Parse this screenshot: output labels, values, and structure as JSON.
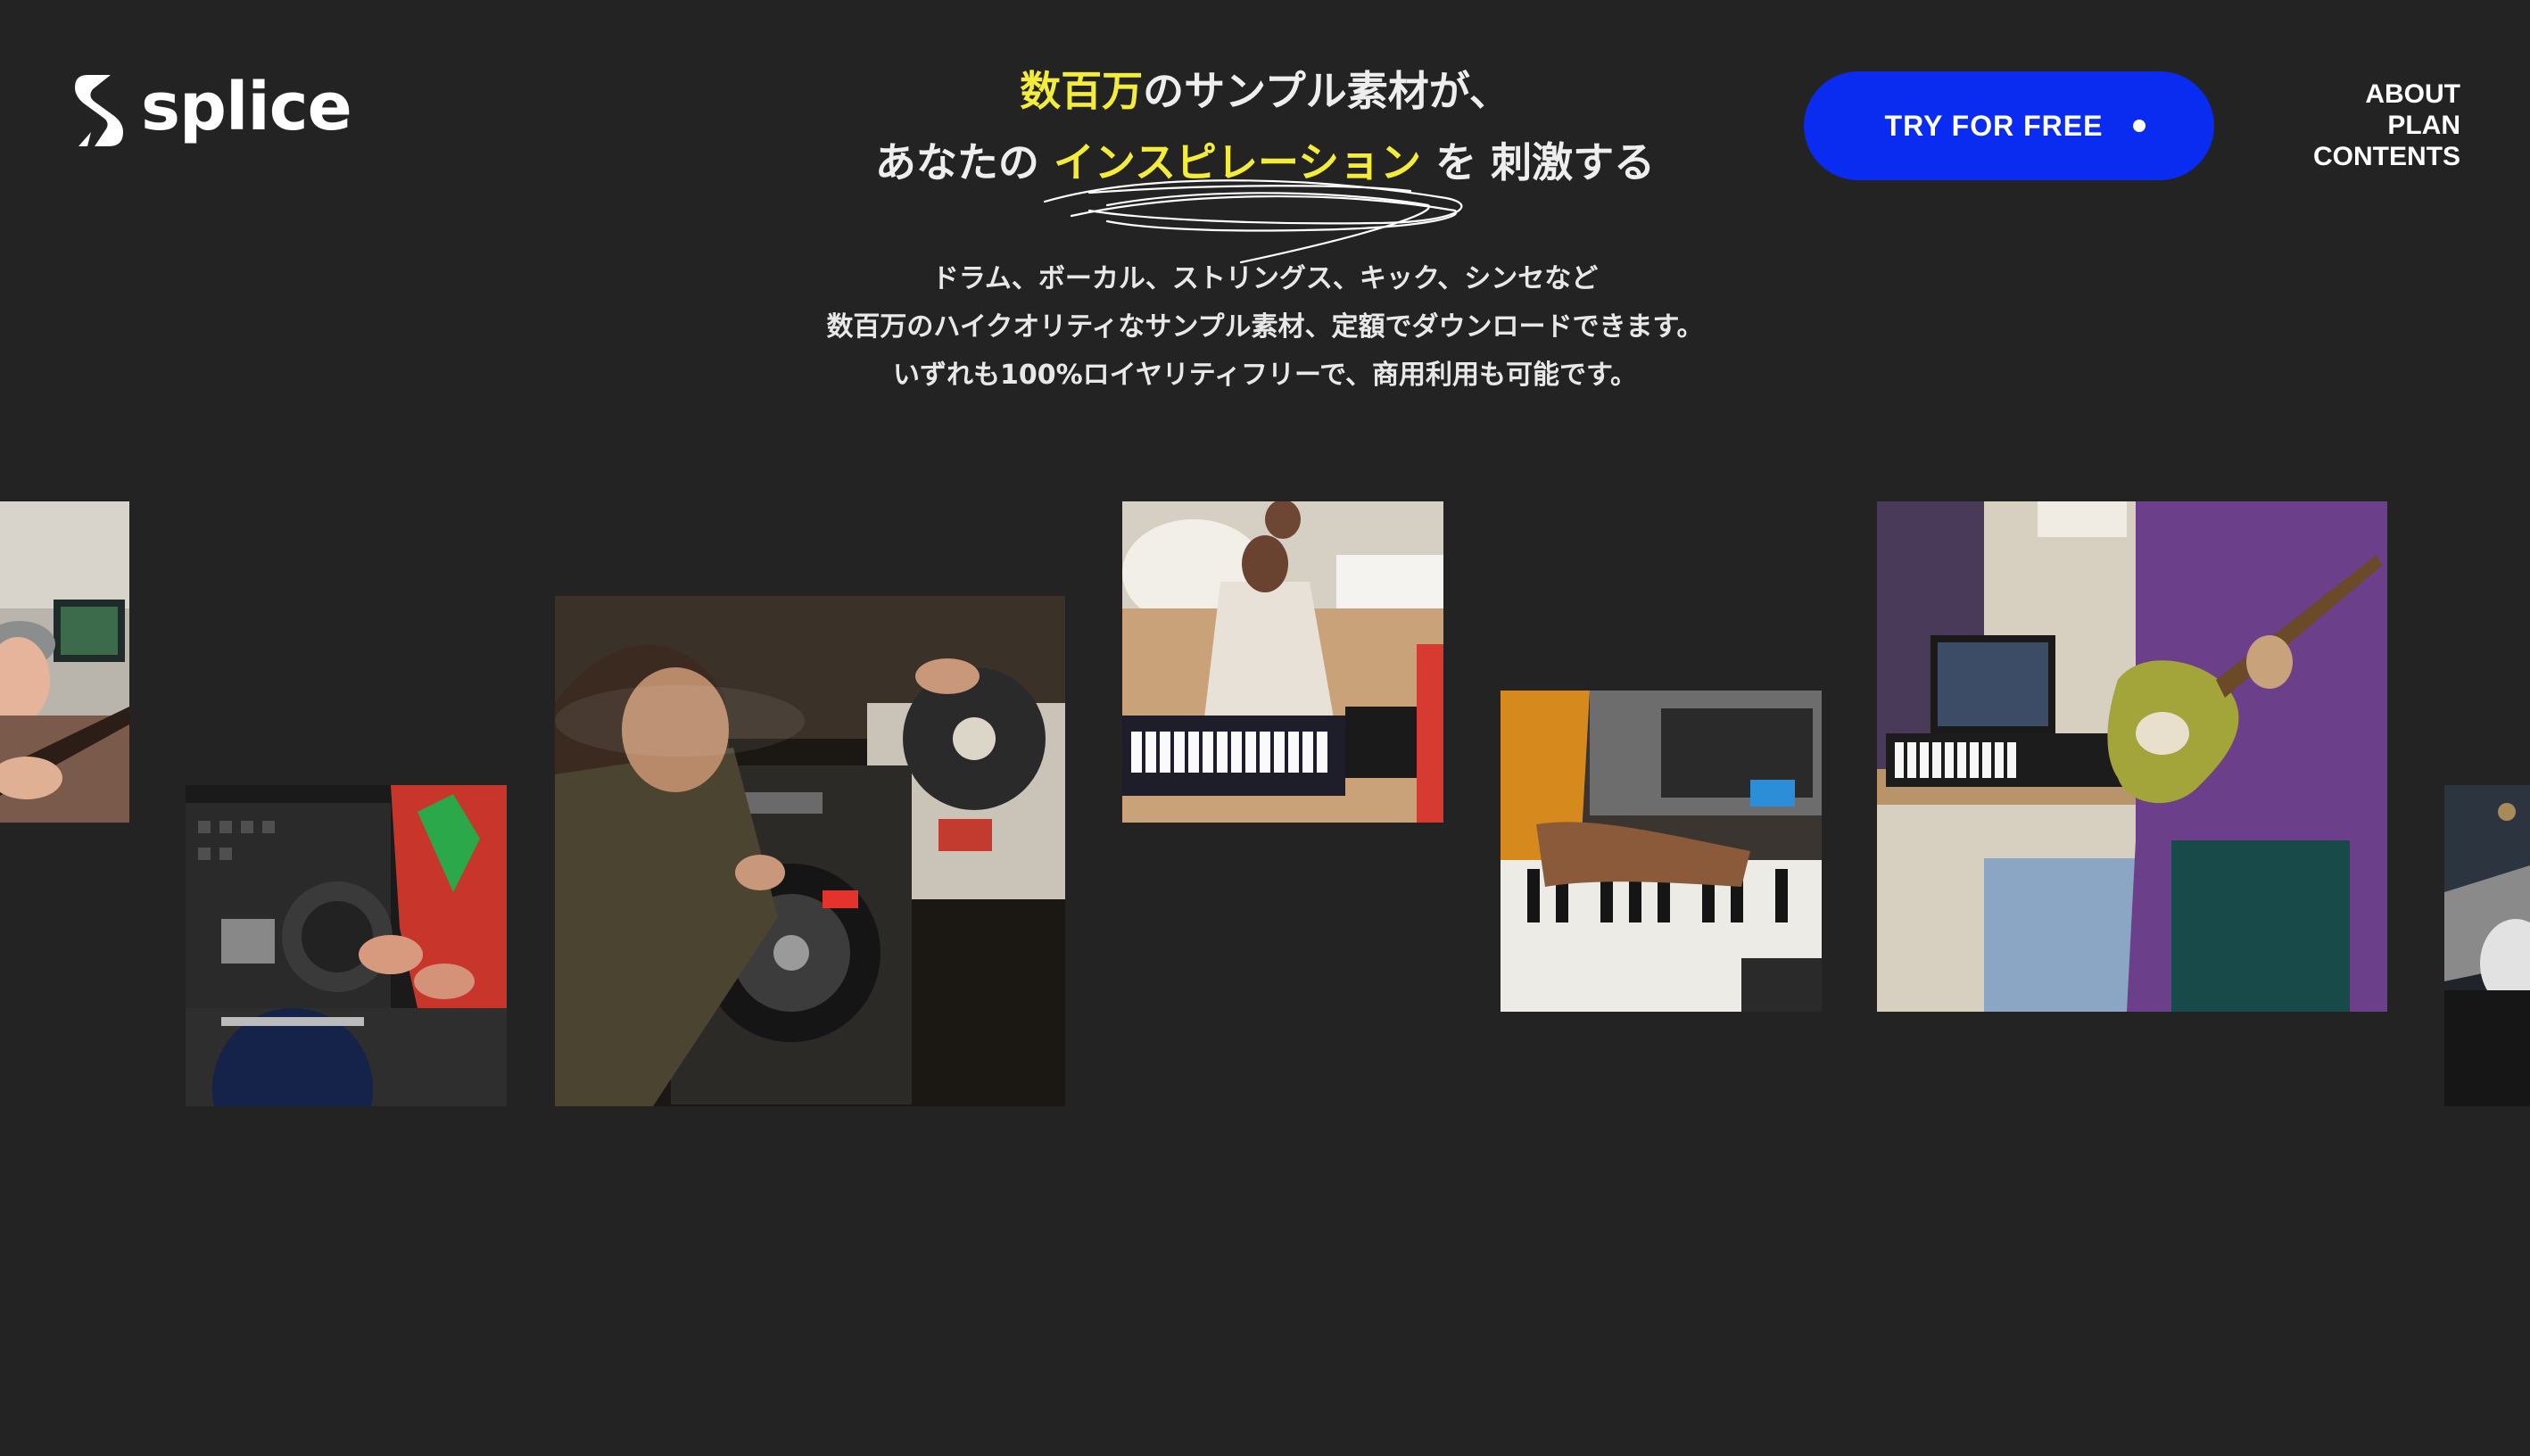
{
  "brand": {
    "name": "splice"
  },
  "headline": {
    "line1_highlight": "数百万",
    "line1_rest": "のサンプル素材が、",
    "line2_prefix": "あなたの",
    "line2_highlight": "インスピレーション",
    "line2_suffix": "を 刺激する"
  },
  "subcopy": {
    "line1": "ドラム、ボーカル、ストリングス、キック、シンセなど",
    "line2": "数百万のハイクオリティなサンプル素材、定額でダウンロードできます。",
    "line3": "いずれも100%ロイヤリティフリーで、商用利用も可能です。"
  },
  "cta": {
    "label": "TRY FOR FREE"
  },
  "nav": {
    "items": [
      "ABOUT",
      "PLAN",
      "CONTENTS"
    ]
  },
  "colors": {
    "background": "#232323",
    "accent_blue": "#0a2bf0",
    "highlight_yellow": "#f4ec3a"
  },
  "gallery": {
    "photos": [
      {
        "subject": "guitarist-in-studio"
      },
      {
        "subject": "dj-mixer-closeup"
      },
      {
        "subject": "dj-with-turntables"
      },
      {
        "subject": "father-and-child-with-keyboard"
      },
      {
        "subject": "hands-on-piano-keys"
      },
      {
        "subject": "guitarist-with-green-guitar"
      },
      {
        "subject": "performer-partial"
      }
    ]
  }
}
